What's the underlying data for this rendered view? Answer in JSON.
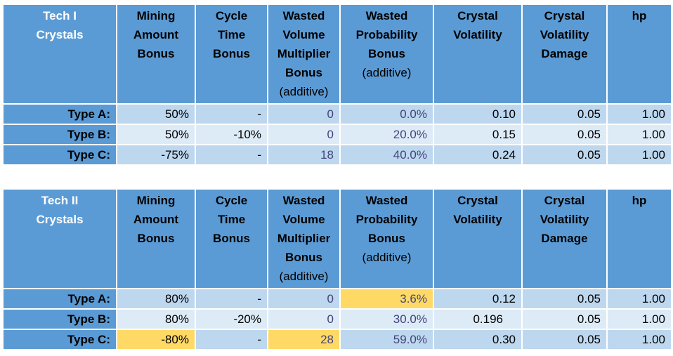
{
  "colors": {
    "header": "#5b9bd5",
    "row_dark": "#bdd7ee",
    "row_light": "#ddebf7",
    "highlight": "#ffd966"
  },
  "columns": [
    {
      "lines": [
        "Mining",
        "Amount",
        "Bonus"
      ],
      "sub": ""
    },
    {
      "lines": [
        "Cycle",
        "Time",
        "Bonus"
      ],
      "sub": ""
    },
    {
      "lines": [
        "Wasted",
        "Volume",
        "Multiplier",
        "Bonus"
      ],
      "sub": "(additive)"
    },
    {
      "lines": [
        "Wasted",
        "Probability",
        "Bonus"
      ],
      "sub": "(additive)"
    },
    {
      "lines": [
        "Crystal",
        "Volatility"
      ],
      "sub": ""
    },
    {
      "lines": [
        "Crystal",
        "Volatility",
        "Damage"
      ],
      "sub": ""
    },
    {
      "lines": [
        "hp"
      ],
      "sub": ""
    }
  ],
  "tables": [
    {
      "title": [
        "Tech I",
        "Crystals"
      ],
      "rows": [
        {
          "label": "Type A:",
          "values": [
            "50%",
            "-",
            "0",
            "0.0%",
            "0.10",
            "0.05",
            "1.00"
          ],
          "highlight": []
        },
        {
          "label": "Type B:",
          "values": [
            "50%",
            "-10%",
            "0",
            "20.0%",
            "0.15",
            "0.05",
            "1.00"
          ],
          "highlight": []
        },
        {
          "label": "Type C:",
          "values": [
            "-75%",
            "-",
            "18",
            "40.0%",
            "0.24",
            "0.05",
            "1.00"
          ],
          "highlight": []
        }
      ]
    },
    {
      "title": [
        "Tech II",
        "Crystals"
      ],
      "rows": [
        {
          "label": "Type A:",
          "values": [
            "80%",
            "-",
            "0",
            "3.6%",
            "0.12",
            "0.05",
            "1.00"
          ],
          "highlight": [
            3
          ]
        },
        {
          "label": "Type B:",
          "values": [
            "80%",
            "-20%",
            "0",
            "30.0%",
            "0.196",
            "0.05",
            "1.00"
          ],
          "highlight": []
        },
        {
          "label": "Type C:",
          "values": [
            "-80%",
            "-",
            "28",
            "59.0%",
            "0.30",
            "0.05",
            "1.00"
          ],
          "highlight": [
            0,
            2
          ]
        }
      ]
    }
  ]
}
